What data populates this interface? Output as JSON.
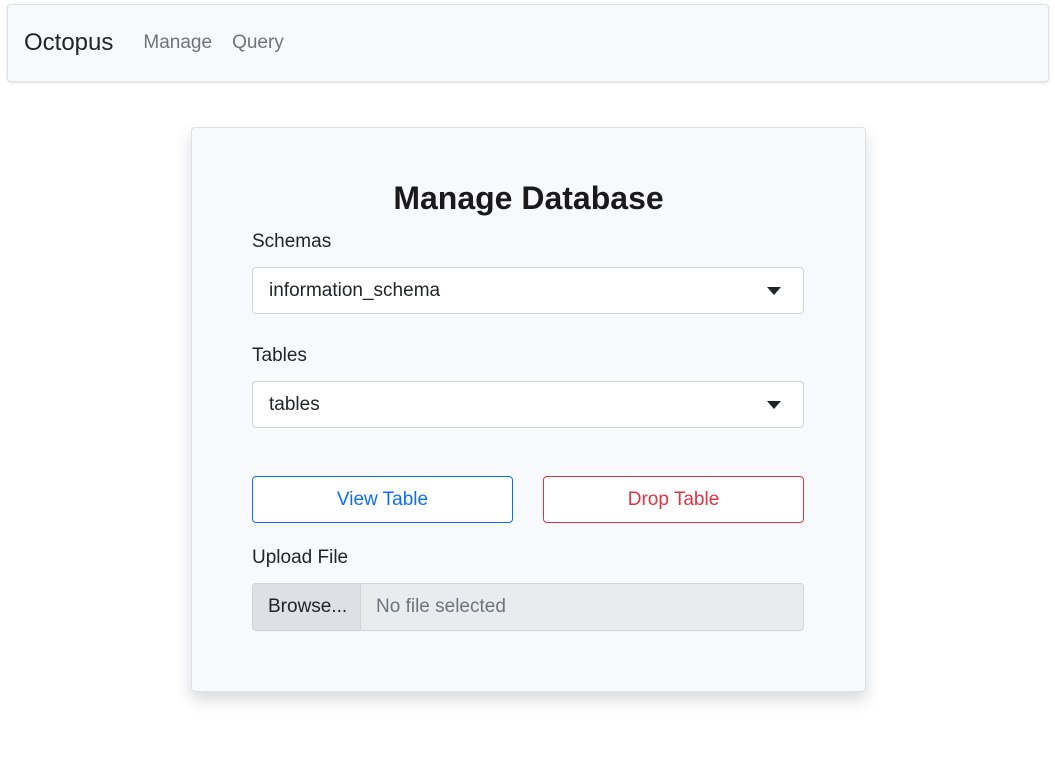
{
  "navbar": {
    "brand": "Octopus",
    "links": [
      {
        "label": "Manage"
      },
      {
        "label": "Query"
      }
    ]
  },
  "card": {
    "title": "Manage Database",
    "schemas": {
      "label": "Schemas",
      "selected": "information_schema"
    },
    "tables": {
      "label": "Tables",
      "selected": "tables"
    },
    "buttons": {
      "view_label": "View Table",
      "drop_label": "Drop Table"
    },
    "upload": {
      "label": "Upload File",
      "browse_label": "Browse...",
      "file_status": "No file selected"
    }
  },
  "colors": {
    "primary": "#0d6efd",
    "danger": "#dc3545",
    "navbar_bg": "#f8f9fa"
  },
  "icons": {
    "select_caret": "caret-down-icon"
  }
}
